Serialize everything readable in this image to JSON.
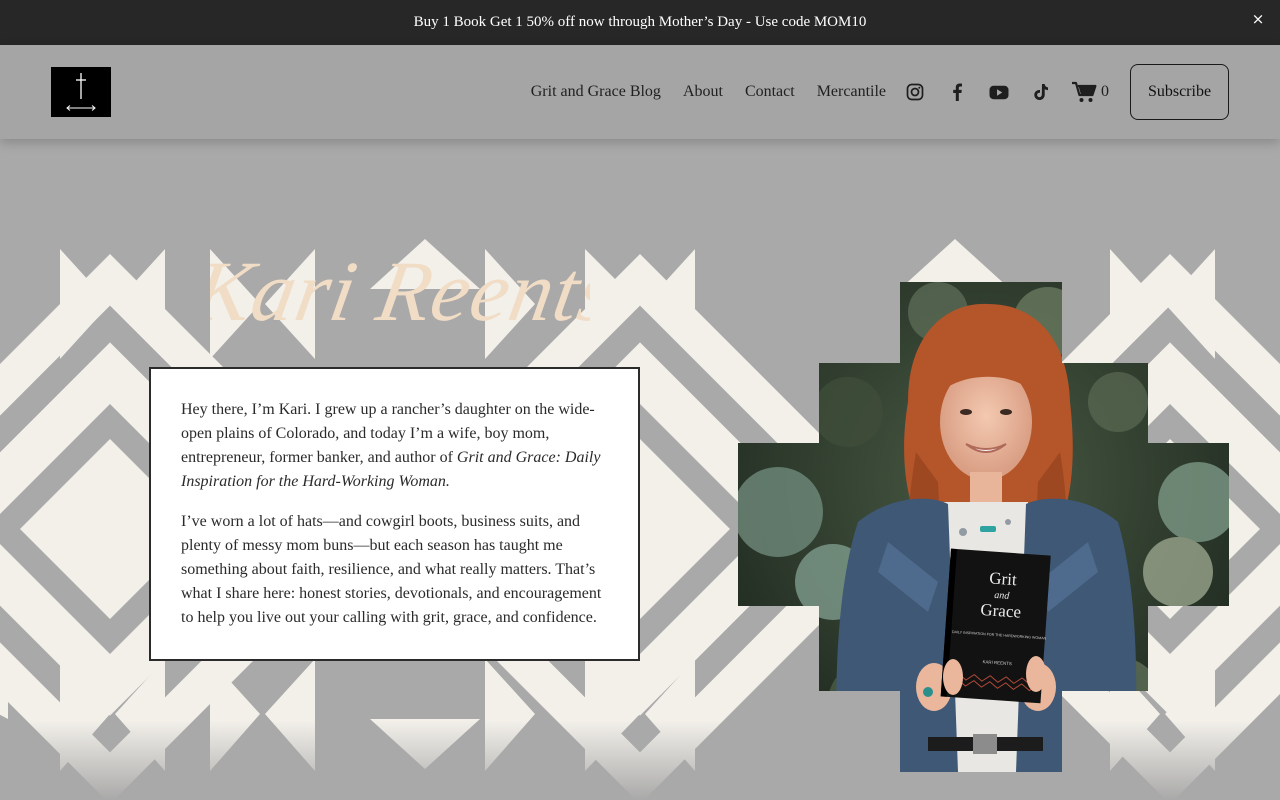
{
  "announcement": {
    "text": "Buy 1 Book Get 1 50% off now through Mother’s Day - Use code MOM10",
    "close": "×"
  },
  "header": {
    "nav": [
      {
        "label": "Grit and Grace Blog"
      },
      {
        "label": "About"
      },
      {
        "label": "Contact"
      },
      {
        "label": "Mercantile"
      }
    ],
    "social_icons": [
      "instagram-icon",
      "facebook-icon",
      "youtube-icon",
      "tiktok-icon"
    ],
    "cart_count": "0",
    "subscribe_label": "Subscribe"
  },
  "hero": {
    "script_title": "Kari Reents",
    "para1_start": "Hey there, I’m Kari. I grew up a rancher’s daughter on the wide-open plains of Colorado, and today I’m a wife, boy mom, entrepreneur, former banker, and author of ",
    "para1_italic": "Grit and Grace: Daily Inspiration for the Hard-Working Woman.",
    "para2": "I’ve worn a lot of hats—and cowgirl boots, business suits, and plenty of messy mom buns—but each season has taught me something about faith, resilience, and what really matters. That’s what I share here: honest stories, devotionals, and encouragement to help you live out your calling with grit, grace, and confidence.",
    "book": {
      "title_line1": "Grit",
      "title_line2": "and",
      "title_line3": "Grace",
      "subtitle": "DAILY INSPIRATION FOR THE HARDWORKING WOMAN",
      "author": "KARI REENTS"
    }
  },
  "colors": {
    "announcement_bg": "#272727",
    "header_bg": "#a5a5a5",
    "hero_bg": "#a9a9a9",
    "pattern_light": "#f3f0ea",
    "script_color": "#f1dcc6"
  }
}
